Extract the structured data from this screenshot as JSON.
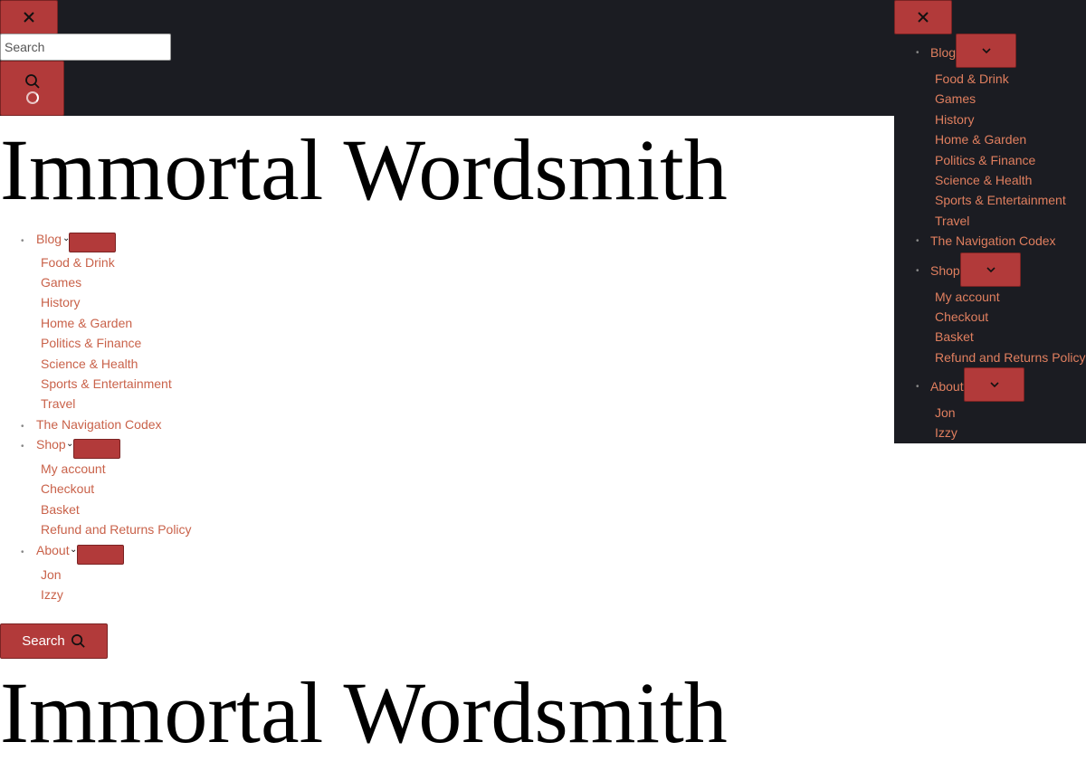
{
  "top": {
    "search_placeholder": "Search"
  },
  "site_title": "Immortal Wordsmith",
  "nav": {
    "blog": "Blog",
    "blog_items": [
      "Food & Drink",
      "Games",
      "History",
      "Home & Garden",
      "Politics & Finance",
      "Science & Health",
      "Sports & Entertainment",
      "Travel"
    ],
    "codex": "The Navigation Codex",
    "shop": "Shop",
    "shop_items": [
      "My account",
      "Checkout",
      "Basket",
      "Refund and Returns Policy"
    ],
    "about": "About",
    "about_items": [
      "Jon",
      "Izzy"
    ]
  },
  "search_button_label": "Search",
  "icons": {
    "close": "close-icon",
    "search": "search-icon",
    "chevron": "chevron-down-icon",
    "spinner": "loading-spinner-icon"
  },
  "colors": {
    "dark_bg": "#1b1c22",
    "accent": "#b23a3a",
    "link": "#c9624a"
  }
}
